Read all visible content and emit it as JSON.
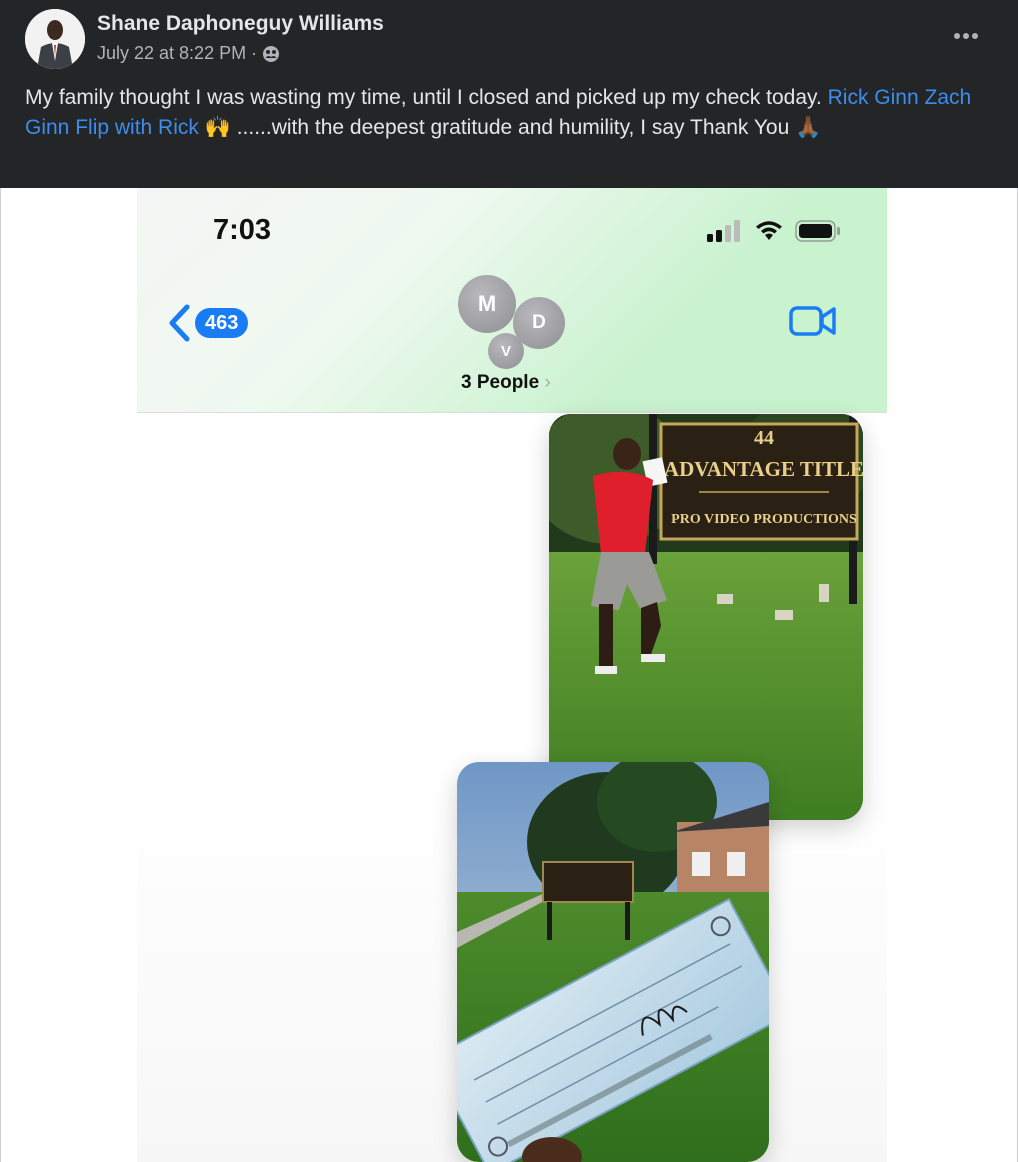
{
  "post": {
    "author": "Shane Daphoneguy Williams",
    "timestamp": "July 22 at 8:22 PM",
    "separator": "·",
    "audience_icon": "custom-audience-icon",
    "more_icon": "more-horizontal-icon",
    "text_before": "My family thought I was wasting my time, until I closed and picked up my check today. ",
    "tags": [
      "Rick Ginn",
      "Zach Ginn",
      "Flip with Rick"
    ],
    "text_after": " 🙌 ......with the deepest gratitude and humility, I say Thank You 🙏🏾"
  },
  "screenshot": {
    "time": "7:03",
    "back_count": "463",
    "group_initials": [
      "M",
      "D",
      "V"
    ],
    "group_label": "3 People",
    "group_chevron": "›",
    "sign": {
      "number": "44",
      "company": "ADVANTAGE TITLE",
      "subtitle": "PRO VIDEO PRODUCTIONS"
    },
    "colors": {
      "header_bg": "#242526",
      "link": "#3b8eed",
      "ios_blue": "#1a7cf5"
    }
  }
}
